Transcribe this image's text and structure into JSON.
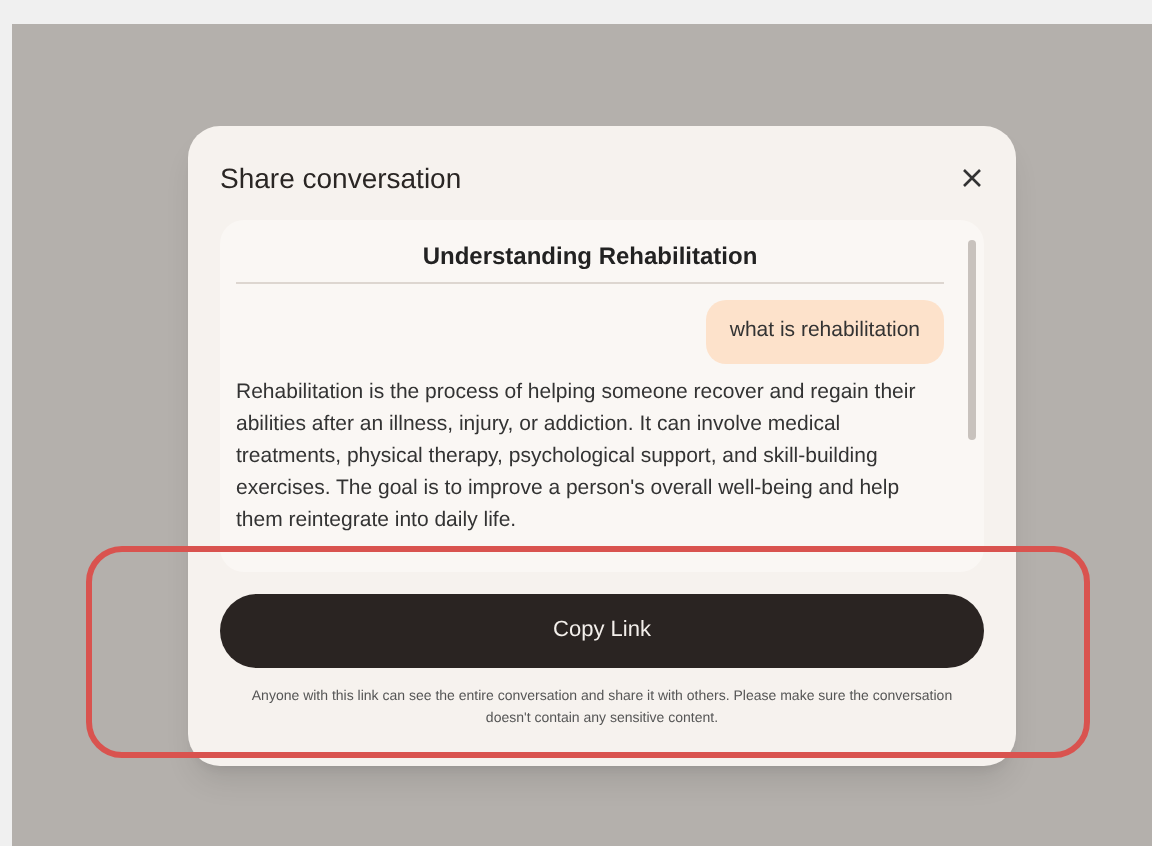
{
  "dialog": {
    "title": "Share conversation",
    "conversation": {
      "title": "Understanding Rehabilitation",
      "messages": [
        {
          "kind": "user",
          "text": "what is rehabilitation"
        },
        {
          "kind": "assistant",
          "text": "Rehabilitation is the process of helping someone recover and regain their abilities after an illness, injury, or addiction. It can involve medical treatments, physical therapy, psychological support, and skill-building exercises. The goal is to improve a person's overall well-being and help them reintegrate into daily life."
        }
      ]
    },
    "button": "Copy Link",
    "notice": "Anyone with this link can see the entire conversation and share it with others. Please make sure the conversation doesn't contain any sensitive content."
  }
}
